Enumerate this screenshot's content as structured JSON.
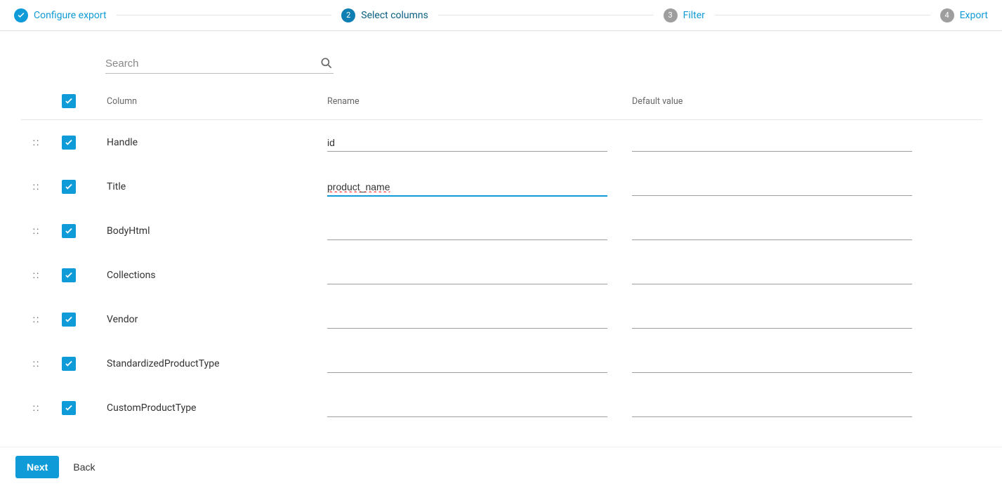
{
  "stepper": {
    "steps": [
      {
        "label": "Configure export",
        "state": "done"
      },
      {
        "label": "Select columns",
        "state": "active",
        "num": "2"
      },
      {
        "label": "Filter",
        "state": "pending",
        "num": "3"
      },
      {
        "label": "Export",
        "state": "pending",
        "num": "4"
      }
    ]
  },
  "search": {
    "placeholder": "Search"
  },
  "table": {
    "headers": {
      "column": "Column",
      "rename": "Rename",
      "default": "Default value"
    },
    "rows": [
      {
        "name": "Handle",
        "rename": "id",
        "default": "",
        "checked": true
      },
      {
        "name": "Title",
        "rename": "product_name",
        "default": "",
        "checked": true,
        "rename_focused": true,
        "rename_spellcheck": true
      },
      {
        "name": "BodyHtml",
        "rename": "",
        "default": "",
        "checked": true
      },
      {
        "name": "Collections",
        "rename": "",
        "default": "",
        "checked": true
      },
      {
        "name": "Vendor",
        "rename": "",
        "default": "",
        "checked": true
      },
      {
        "name": "StandardizedProductType",
        "rename": "",
        "default": "",
        "checked": true
      },
      {
        "name": "CustomProductType",
        "rename": "",
        "default": "",
        "checked": true
      }
    ]
  },
  "footer": {
    "next": "Next",
    "back": "Back"
  }
}
